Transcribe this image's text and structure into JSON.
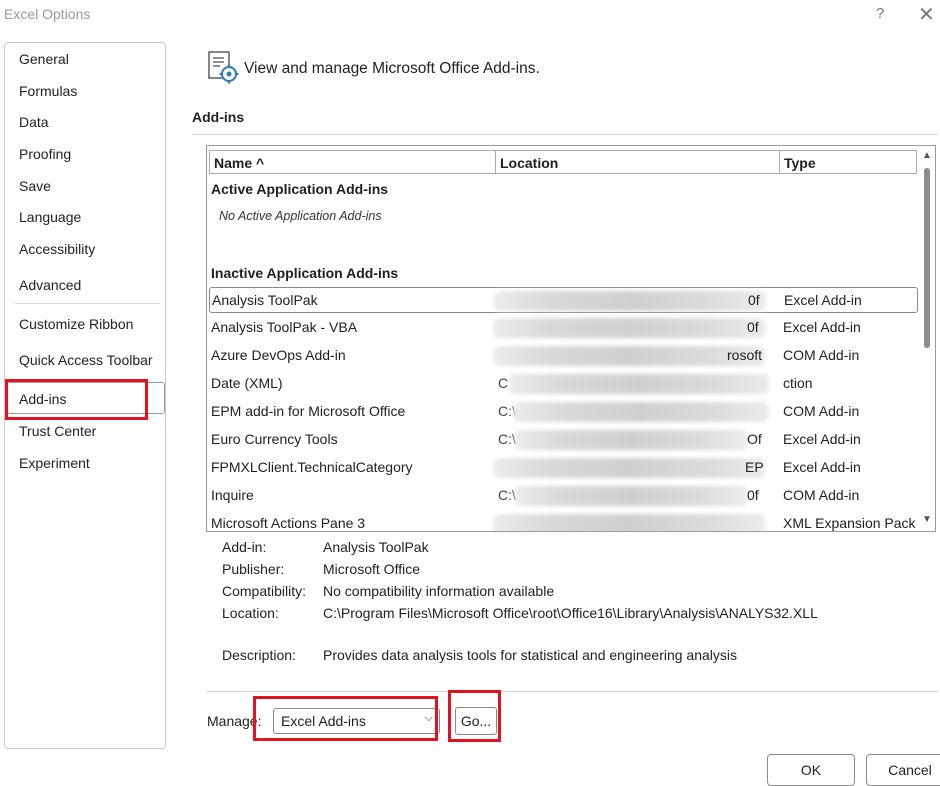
{
  "window": {
    "title": "Excel Options",
    "help": "?",
    "close": "✕"
  },
  "sidebar": {
    "items": [
      {
        "label": "General"
      },
      {
        "label": "Formulas"
      },
      {
        "label": "Data"
      },
      {
        "label": "Proofing"
      },
      {
        "label": "Save"
      },
      {
        "label": "Language"
      },
      {
        "label": "Accessibility"
      },
      {
        "label": "Advanced"
      },
      {
        "label": "Customize Ribbon"
      },
      {
        "label": "Quick Access Toolbar"
      },
      {
        "label": "Add-ins",
        "selected": true
      },
      {
        "label": "Trust Center"
      },
      {
        "label": "Experiment"
      }
    ]
  },
  "header": {
    "icon": "addins-gear-icon",
    "text": "View and manage Microsoft Office Add-ins."
  },
  "section": {
    "title": "Add-ins"
  },
  "table": {
    "columns": {
      "name": "Name ^",
      "location": "Location",
      "type": "Type"
    },
    "active_group": "Active Application Add-ins",
    "active_empty": "No Active Application Add-ins",
    "inactive_group": "Inactive Application Add-ins",
    "rows": [
      {
        "name": "Analysis ToolPak",
        "loc_head": "",
        "loc_tail": "0f",
        "type": "Excel Add-in"
      },
      {
        "name": "Analysis ToolPak - VBA",
        "loc_head": "",
        "loc_tail": "0f",
        "type": "Excel Add-in"
      },
      {
        "name": "Azure DevOps Add-in",
        "loc_head": "",
        "loc_tail": "rosoft",
        "type": "COM Add-in"
      },
      {
        "name": "Date (XML)",
        "loc_head": "C",
        "loc_tail": "",
        "type": "ction"
      },
      {
        "name": "EPM add-in for Microsoft Office",
        "loc_head": "C:\\",
        "loc_tail": "",
        "type": "COM Add-in"
      },
      {
        "name": "Euro Currency Tools",
        "loc_head": "C:\\",
        "loc_tail": "Of",
        "type": "Excel Add-in"
      },
      {
        "name": "FPMXLClient.TechnicalCategory",
        "loc_head": "",
        "loc_tail": "EP",
        "type": "Excel Add-in"
      },
      {
        "name": "Inquire",
        "loc_head": "C:\\",
        "loc_tail": "0f",
        "type": "COM Add-in"
      },
      {
        "name": "Microsoft Actions Pane 3",
        "loc_head": "",
        "loc_tail": "",
        "type": "XML Expansion Pack"
      }
    ]
  },
  "details": {
    "addin_label": "Add-in:",
    "addin_value": "Analysis ToolPak",
    "publisher_label": "Publisher:",
    "publisher_value": "Microsoft Office",
    "compat_label": "Compatibility:",
    "compat_value": "No compatibility information available",
    "location_label": "Location:",
    "location_value": "C:\\Program Files\\Microsoft Office\\root\\Office16\\Library\\Analysis\\ANALYS32.XLL",
    "desc_label": "Description:",
    "desc_value": "Provides data analysis tools for statistical and engineering analysis"
  },
  "manage": {
    "label": "Manage:",
    "selected": "Excel Add-ins",
    "go": "Go..."
  },
  "footer": {
    "ok": "OK",
    "cancel": "Cancel"
  },
  "colors": {
    "highlight": "#e0141e",
    "border": "#9a9a9a"
  }
}
